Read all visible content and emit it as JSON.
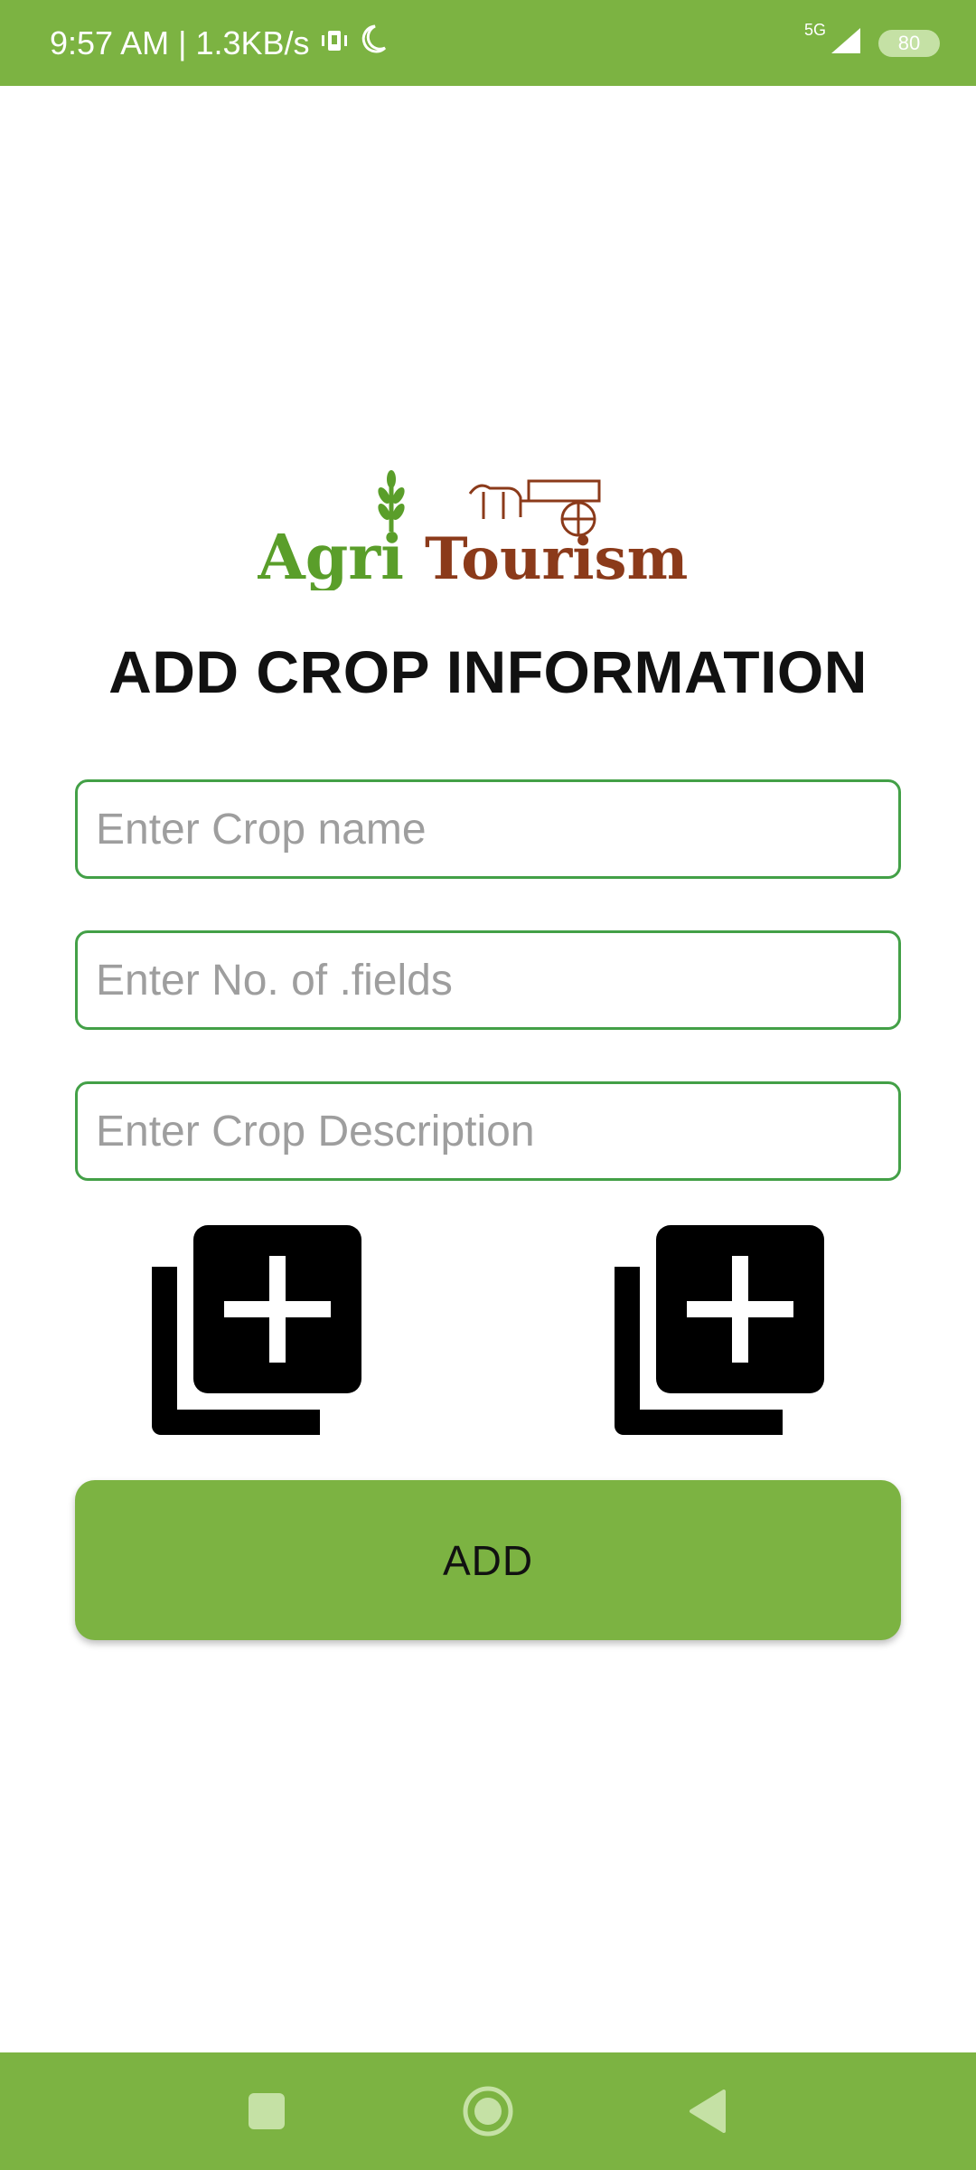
{
  "status_bar": {
    "time_speed": "9:57 AM | 1.3KB/s",
    "network": "5G",
    "battery": "80",
    "icons": [
      "vibrate-icon",
      "moon-icon",
      "signal-icon"
    ]
  },
  "logo": {
    "text_left": "Agri",
    "text_right": "Tourism",
    "colors": {
      "agri": "#5a9e2a",
      "tourism": "#8b3a1a"
    }
  },
  "page": {
    "title": "ADD CROP INFORMATION"
  },
  "form": {
    "crop_name": {
      "value": "",
      "placeholder": "Enter Crop name"
    },
    "fields_count": {
      "value": "",
      "placeholder": "Enter No. of .fields"
    },
    "description": {
      "value": "",
      "placeholder": "Enter Crop Description"
    },
    "image_pickers": [
      "add-photo-icon",
      "add-photo-icon"
    ],
    "submit_label": "ADD"
  },
  "nav": {
    "buttons": [
      "recents-square-icon",
      "home-circle-icon",
      "back-triangle-icon"
    ]
  },
  "theme": {
    "accent": "#7cb342",
    "field_border": "#43a047"
  }
}
